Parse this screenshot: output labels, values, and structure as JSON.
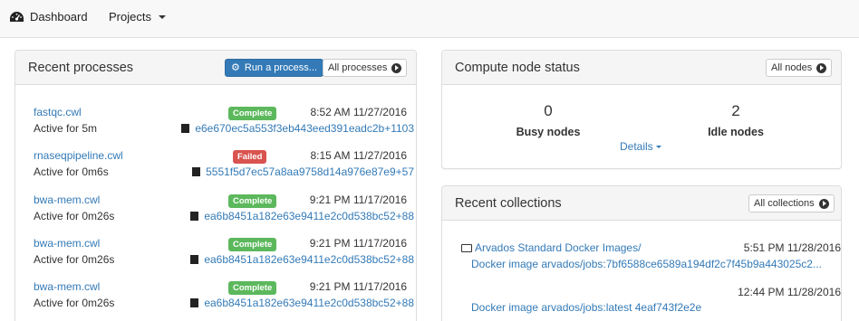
{
  "nav": {
    "dashboard_label": "Dashboard",
    "dashboard_icon": "dashboard-icon",
    "projects_label": "Projects"
  },
  "recent_processes": {
    "title": "Recent processes",
    "run_button_label": "Run a process...",
    "all_button_label": "All processes",
    "items": [
      {
        "name": "fastqc.cwl",
        "status": "Complete",
        "time": "8:52 AM 11/27/2016",
        "active": "Active for 5m",
        "hash": "e6e670ec5a553f3eb443eed391eadc2b+1103"
      },
      {
        "name": "rnaseqpipeline.cwl",
        "status": "Failed",
        "time": "8:15 AM 11/27/2016",
        "active": "Active for 0m6s",
        "hash": "5551f5d7ec57a8aa9758d14a976e87e9+57"
      },
      {
        "name": "bwa-mem.cwl",
        "status": "Complete",
        "time": "9:21 PM 11/17/2016",
        "active": "Active for 0m26s",
        "hash": "ea6b8451a182e63e9411e2c0d538bc52+88"
      },
      {
        "name": "bwa-mem.cwl",
        "status": "Complete",
        "time": "9:21 PM 11/17/2016",
        "active": "Active for 0m26s",
        "hash": "ea6b8451a182e63e9411e2c0d538bc52+88"
      },
      {
        "name": "bwa-mem.cwl",
        "status": "Complete",
        "time": "9:21 PM 11/17/2016",
        "active": "Active for 0m26s",
        "hash": "ea6b8451a182e63e9411e2c0d538bc52+88"
      }
    ]
  },
  "compute_nodes": {
    "title": "Compute node status",
    "all_button_label": "All nodes",
    "busy_count": "0",
    "busy_label": "Busy nodes",
    "idle_count": "2",
    "idle_label": "Idle nodes",
    "details_label": "Details"
  },
  "recent_collections": {
    "title": "Recent collections",
    "all_button_label": "All collections",
    "items": [
      {
        "project": "Arvados Standard Docker Images/",
        "time": "5:51 PM 11/28/2016",
        "name": "Docker image arvados/jobs:7bf6588ce6589a194df2c7f45b9a443025c2..."
      },
      {
        "project": "",
        "time": "12:44 PM 11/28/2016",
        "name": "Docker image arvados/jobs:latest 4eaf743f2e2e"
      }
    ]
  },
  "colors": {
    "link": "#337ab7",
    "complete": "#5cb85c",
    "failed": "#d9534f",
    "primary": "#337ab7"
  }
}
